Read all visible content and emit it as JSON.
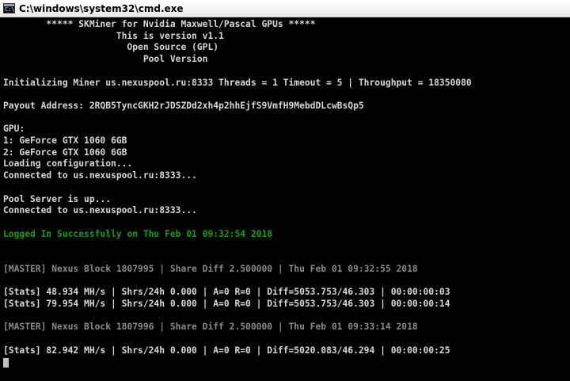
{
  "window": {
    "title": "C:\\windows\\system32\\cmd.exe",
    "icon_text": "C:\\"
  },
  "console": {
    "lines": [
      {
        "text": "        ***** SKMiner for Nvidia Maxwell/Pascal GPUs *****",
        "style": "white"
      },
      {
        "text": "                     This is version v1.1",
        "style": "white"
      },
      {
        "text": "                       Open Source (GPL)",
        "style": "white"
      },
      {
        "text": "                          Pool Version",
        "style": "white"
      },
      {
        "text": "",
        "style": "white"
      },
      {
        "text": "Initializing Miner us.nexuspool.ru:8333 Threads = 1 Timeout = 5 | Throughput = 18350080",
        "style": "white"
      },
      {
        "text": "",
        "style": "white"
      },
      {
        "text": "Payout Address: 2RQB5TyncGKH2rJDSZDd2xh4p2hhEjfS9VmfH9MebdDLcwBsQp5",
        "style": "white"
      },
      {
        "text": "",
        "style": "white"
      },
      {
        "text": "GPU:",
        "style": "white"
      },
      {
        "text": "1: GeForce GTX 1060 6GB",
        "style": "white"
      },
      {
        "text": "2: GeForce GTX 1060 6GB",
        "style": "white"
      },
      {
        "text": "Loading configuration...",
        "style": "white"
      },
      {
        "text": "Connected to us.nexuspool.ru:8333...",
        "style": "white"
      },
      {
        "text": "",
        "style": "white"
      },
      {
        "text": "Pool Server is up...",
        "style": "white"
      },
      {
        "text": "Connected to us.nexuspool.ru:8333...",
        "style": "white"
      },
      {
        "text": "",
        "style": "white"
      },
      {
        "text": "Logged In Successfully on Thu Feb 01 09:32:54 2018",
        "style": "green"
      },
      {
        "text": "",
        "style": "white"
      },
      {
        "text": "",
        "style": "white"
      },
      {
        "text": "[MASTER] Nexus Block 1807995 | Share Diff 2.500000 | Thu Feb 01 09:32:55 2018",
        "style": "gray"
      },
      {
        "text": "",
        "style": "white"
      },
      {
        "text": "[Stats] 48.934 MH/s | Shrs/24h 0.000 | A=0 R=0 | Diff=5053.753/46.303 | 00:00:00:03",
        "style": "white"
      },
      {
        "text": "[Stats] 79.954 MH/s | Shrs/24h 0.000 | A=0 R=0 | Diff=5053.753/46.303 | 00:00:00:14",
        "style": "white"
      },
      {
        "text": "",
        "style": "white"
      },
      {
        "text": "[MASTER] Nexus Block 1807996 | Share Diff 2.500000 | Thu Feb 01 09:33:14 2018",
        "style": "gray"
      },
      {
        "text": "",
        "style": "white"
      },
      {
        "text": "[Stats] 82.942 MH/s | Shrs/24h 0.000 | A=0 R=0 | Diff=5020.083/46.294 | 00:00:00:25",
        "style": "white"
      }
    ]
  },
  "colors": {
    "background": "#000000",
    "text": "#c0c0c0",
    "success": "#13a10e",
    "master": "#8a8a8a"
  }
}
